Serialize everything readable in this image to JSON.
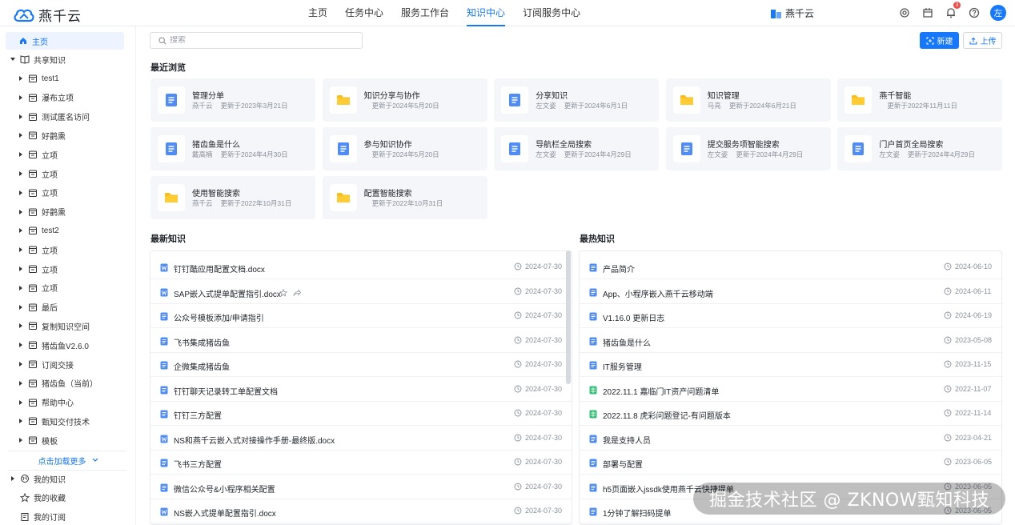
{
  "header": {
    "app_name": "燕千云",
    "nav": [
      "主页",
      "任务中心",
      "服务工作台",
      "知识中心",
      "订阅服务中心"
    ],
    "active_nav": "知识中心",
    "tenant": "燕千云",
    "notification_count": "3",
    "avatar_text": "左",
    "colors": {
      "brand": "#1677ff",
      "badge": "#f54a45"
    }
  },
  "sidebar": {
    "home": "主页",
    "shared_knowledge": "共享知识",
    "spaces": [
      "test1",
      "瀑布立项",
      "测试匿名访问",
      "好鹳熏",
      "立项",
      "立项",
      "立项",
      "好鹳熏",
      "test2",
      "立项",
      "立项",
      "立项",
      "最后",
      "复制知识空间",
      "猪齿鱼V2.6.0",
      "订阅交接",
      "猪齿鱼（当前）",
      "帮助中心",
      "甄知交付技术",
      "模板"
    ],
    "load_more": "点击加载更多",
    "footer": [
      "我的知识",
      "我的收藏",
      "我的订阅"
    ]
  },
  "toolbar": {
    "search_placeholder": "搜索",
    "new_label": "新建",
    "upload_label": "上传"
  },
  "recent": {
    "title": "最近浏览",
    "items": [
      {
        "title": "管理分单",
        "author": "燕千云",
        "updated": "更新于2023年3月21日",
        "type": "doc"
      },
      {
        "title": "知识分享与协作",
        "author": "",
        "updated": "更新于2024年5月20日",
        "type": "folder"
      },
      {
        "title": "分享知识",
        "author": "左文姿",
        "updated": "更新于2024年6月1日",
        "type": "doc"
      },
      {
        "title": "知识管理",
        "author": "马亮",
        "updated": "更新于2024年6月21日",
        "type": "folder"
      },
      {
        "title": "燕千智能",
        "author": "",
        "updated": "更新于2022年11月11日",
        "type": "folder"
      },
      {
        "title": "猪齿鱼是什么",
        "author": "戴高楠",
        "updated": "更新于2024年4月30日",
        "type": "doc"
      },
      {
        "title": "参与知识协作",
        "author": "",
        "updated": "更新于2024年5月20日",
        "type": "doc"
      },
      {
        "title": "导航栏全局搜索",
        "author": "左文姿",
        "updated": "更新于2024年4月29日",
        "type": "doc"
      },
      {
        "title": "提交服务项智能搜索",
        "author": "左文姿",
        "updated": "更新于2024年4月29日",
        "type": "doc"
      },
      {
        "title": "门户首页全局搜索",
        "author": "左文姿",
        "updated": "更新于2024年4月29日",
        "type": "doc"
      },
      {
        "title": "使用智能搜索",
        "author": "燕千云",
        "updated": "更新于2022年10月31日",
        "type": "folder"
      },
      {
        "title": "配置智能搜索",
        "author": "",
        "updated": "更新于2022年10月31日",
        "type": "folder"
      }
    ]
  },
  "latest": {
    "title": "最新知识",
    "items": [
      {
        "title": "钉钉酷应用配置文档.docx",
        "date": "2024-07-30",
        "type": "word"
      },
      {
        "title": "SAP嵌入式提单配置指引.docx",
        "date": "2024-07-30",
        "type": "word"
      },
      {
        "title": "公众号模板添加/申请指引",
        "date": "2024-07-30",
        "type": "doc"
      },
      {
        "title": "飞书集成猪齿鱼",
        "date": "2024-07-30",
        "type": "doc"
      },
      {
        "title": "企微集成猪齿鱼",
        "date": "2024-07-30",
        "type": "doc"
      },
      {
        "title": "钉钉聊天记录转工单配置文档",
        "date": "2024-07-30",
        "type": "doc"
      },
      {
        "title": "钉钉三方配置",
        "date": "2024-07-30",
        "type": "doc"
      },
      {
        "title": "NS和燕千云嵌入式对接操作手册-最终版.docx",
        "date": "2024-07-30",
        "type": "word"
      },
      {
        "title": "飞书三方配置",
        "date": "2024-07-30",
        "type": "doc"
      },
      {
        "title": "微信公众号&小程序相关配置",
        "date": "2024-07-30",
        "type": "doc"
      },
      {
        "title": "NS嵌入式提单配置指引.docx",
        "date": "2024-07-30",
        "type": "word"
      }
    ]
  },
  "hottest": {
    "title": "最热知识",
    "items": [
      {
        "title": "产品简介",
        "date": "2024-06-10",
        "type": "doc"
      },
      {
        "title": "App、小程序嵌入燕千云移动端",
        "date": "2024-06-11",
        "type": "doc"
      },
      {
        "title": "V1.16.0 更新日志",
        "date": "2024-06-19",
        "type": "doc"
      },
      {
        "title": "猪齿鱼是什么",
        "date": "2023-05-08",
        "type": "doc"
      },
      {
        "title": "IT服务管理",
        "date": "2023-11-15",
        "type": "doc"
      },
      {
        "title": "2022.11.1 嘉临门IT资产问题清单",
        "date": "2022-11-07",
        "type": "sheet"
      },
      {
        "title": "2022.11.8 虎彩问题登记-有问题版本",
        "date": "2022-11-14",
        "type": "sheet"
      },
      {
        "title": "我是支持人员",
        "date": "2023-04-21",
        "type": "doc"
      },
      {
        "title": "部署与配置",
        "date": "2023-06-05",
        "type": "doc"
      },
      {
        "title": "h5页面嵌入jssdk使用燕千云快捷提单",
        "date": "2023-06-05",
        "type": "doc"
      },
      {
        "title": "1分钟了解扫码提单",
        "date": "2023-06-05",
        "type": "doc"
      }
    ]
  },
  "watermark": "掘金技术社区 @ ZKNOW甄知科技"
}
